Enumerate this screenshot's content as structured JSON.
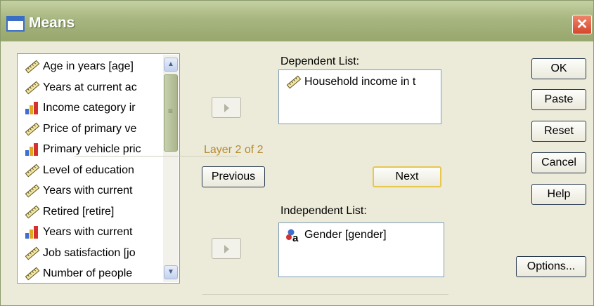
{
  "window": {
    "title": "Means",
    "close_symbol": "✕"
  },
  "variables": [
    {
      "label": "Age in years [age]",
      "type": "scale"
    },
    {
      "label": "Years at current ac",
      "type": "scale"
    },
    {
      "label": "Income category ir",
      "type": "ordinal"
    },
    {
      "label": "Price of primary ve",
      "type": "scale"
    },
    {
      "label": "Primary vehicle pric",
      "type": "ordinal"
    },
    {
      "label": "Level of education",
      "type": "scale"
    },
    {
      "label": "Years with current",
      "type": "scale"
    },
    {
      "label": "Retired [retire]",
      "type": "scale"
    },
    {
      "label": "Years with current",
      "type": "ordinal"
    },
    {
      "label": "Job satisfaction [jo",
      "type": "scale"
    },
    {
      "label": "Number of people",
      "type": "scale"
    }
  ],
  "dependent": {
    "label": "Dependent List:",
    "items": [
      {
        "label": "Household income in t",
        "type": "scale"
      }
    ]
  },
  "layer": {
    "label": "Layer 2 of 2",
    "previous": "Previous",
    "next": "Next"
  },
  "independent": {
    "label": "Independent List:",
    "items": [
      {
        "label": "Gender [gender]",
        "type": "nominal"
      }
    ]
  },
  "buttons": {
    "ok": "OK",
    "paste": "Paste",
    "reset": "Reset",
    "cancel": "Cancel",
    "help": "Help",
    "options": "Options..."
  },
  "icons": {
    "scale": "ruler-icon",
    "ordinal": "bar-chart-icon",
    "nominal": "nominal-icon"
  }
}
